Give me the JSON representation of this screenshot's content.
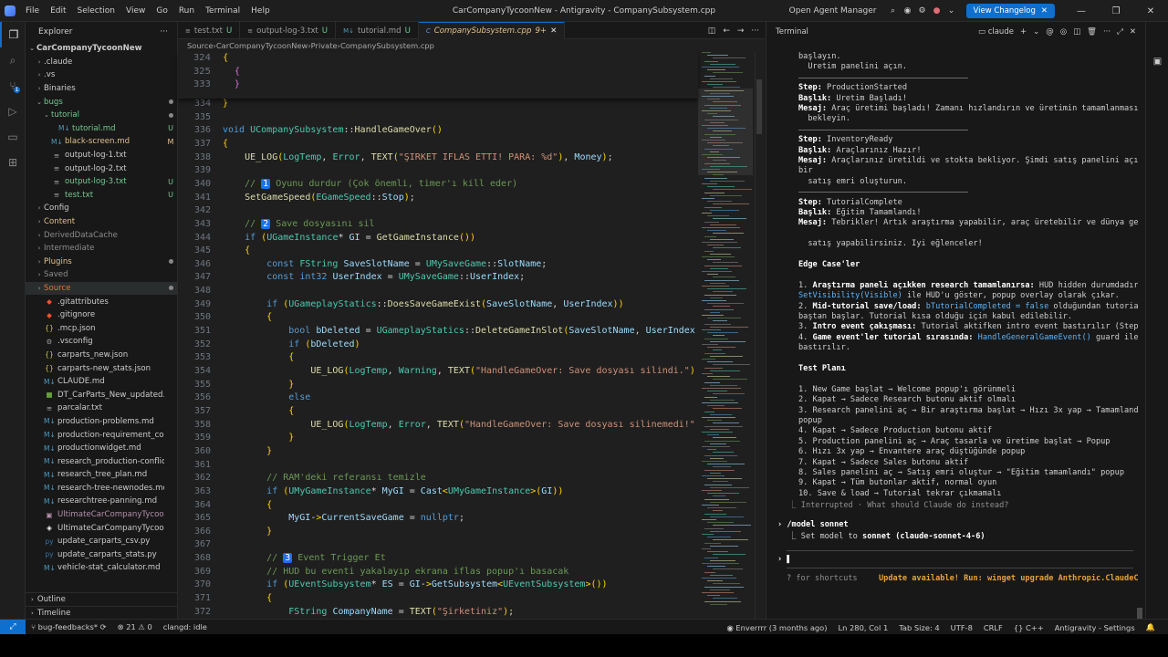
{
  "titlebar": {
    "menus": [
      "File",
      "Edit",
      "Selection",
      "View",
      "Go",
      "Run",
      "Terminal",
      "Help"
    ],
    "title": "CarCompanyTycoonNew - Antigravity - CompanySubsystem.cpp",
    "agent_manager": "Open Agent Manager",
    "changelog_button": "View Changelog"
  },
  "sidebar": {
    "title": "Explorer",
    "root": "CarCompanyTycoonNew",
    "items": [
      {
        "label": ".claude",
        "type": "folder",
        "indent": 1,
        "open": false,
        "status": ""
      },
      {
        "label": ".vs",
        "type": "folder",
        "indent": 1,
        "open": false,
        "status": ""
      },
      {
        "label": "Binaries",
        "type": "folder",
        "indent": 1,
        "open": false,
        "status": ""
      },
      {
        "label": "bugs",
        "type": "folder",
        "indent": 1,
        "open": true,
        "status": "dot",
        "color": "#73c991"
      },
      {
        "label": "tutorial",
        "type": "folder",
        "indent": 2,
        "open": true,
        "status": "dot",
        "color": "#73c991"
      },
      {
        "label": "tutorial.md",
        "type": "md",
        "indent": 3,
        "status": "U",
        "color": "#73c991"
      },
      {
        "label": "black-screen.md",
        "type": "md",
        "indent": 2,
        "status": "M",
        "color": "#e2c08d"
      },
      {
        "label": "output-log-1.txt",
        "type": "txt",
        "indent": 2,
        "status": "",
        "color": "#cccccc"
      },
      {
        "label": "output-log-2.txt",
        "type": "txt",
        "indent": 2,
        "status": "",
        "color": "#cccccc"
      },
      {
        "label": "output-log-3.txt",
        "type": "txt",
        "indent": 2,
        "status": "U",
        "color": "#73c991"
      },
      {
        "label": "test.txt",
        "type": "txt",
        "indent": 2,
        "status": "U",
        "color": "#73c991"
      },
      {
        "label": "Config",
        "type": "folder",
        "indent": 1,
        "open": false,
        "status": ""
      },
      {
        "label": "Content",
        "type": "folder",
        "indent": 1,
        "open": false,
        "status": "",
        "color": "#e2c08d"
      },
      {
        "label": "DerivedDataCache",
        "type": "folder",
        "indent": 1,
        "open": false,
        "status": "",
        "color": "#8c8c8c"
      },
      {
        "label": "Intermediate",
        "type": "folder",
        "indent": 1,
        "open": false,
        "status": "",
        "color": "#8c8c8c"
      },
      {
        "label": "Plugins",
        "type": "folder",
        "indent": 1,
        "open": false,
        "status": "dot",
        "color": "#e2c08d"
      },
      {
        "label": "Saved",
        "type": "folder",
        "indent": 1,
        "open": false,
        "status": "",
        "color": "#8c8c8c"
      },
      {
        "label": "Source",
        "type": "folder",
        "indent": 1,
        "open": false,
        "status": "dot",
        "color": "#e8733a",
        "selected": true
      },
      {
        "label": ".gitattributes",
        "type": "git",
        "indent": 1,
        "status": ""
      },
      {
        "label": ".gitignore",
        "type": "git",
        "indent": 1,
        "status": ""
      },
      {
        "label": ".mcp.json",
        "type": "json",
        "indent": 1,
        "status": ""
      },
      {
        "label": ".vsconfig",
        "type": "cfg",
        "indent": 1,
        "status": ""
      },
      {
        "label": "carparts_new.json",
        "type": "json",
        "indent": 1,
        "status": ""
      },
      {
        "label": "carparts-new_stats.json",
        "type": "json",
        "indent": 1,
        "status": ""
      },
      {
        "label": "CLAUDE.md",
        "type": "md",
        "indent": 1,
        "status": ""
      },
      {
        "label": "DT_CarParts_New_updated.csv",
        "type": "csv",
        "indent": 1,
        "status": ""
      },
      {
        "label": "parcalar.txt",
        "type": "txt",
        "indent": 1,
        "status": ""
      },
      {
        "label": "production-problems.md",
        "type": "md",
        "indent": 1,
        "status": ""
      },
      {
        "label": "production-requirement_conflict...",
        "type": "md",
        "indent": 1,
        "status": ""
      },
      {
        "label": "productionwidget.md",
        "type": "md",
        "indent": 1,
        "status": ""
      },
      {
        "label": "research_production-conflicts.md",
        "type": "md",
        "indent": 1,
        "status": ""
      },
      {
        "label": "research_tree_plan.md",
        "type": "md",
        "indent": 1,
        "status": ""
      },
      {
        "label": "research-tree-newnodes.md",
        "type": "md",
        "indent": 1,
        "status": ""
      },
      {
        "label": "researchtree-panning.md",
        "type": "md",
        "indent": 1,
        "status": ""
      },
      {
        "label": "UltimateCarCompanyTycoon.sln",
        "type": "sln",
        "indent": 1,
        "status": "",
        "color": "#b48ead"
      },
      {
        "label": "UltimateCarCompanyTycoon.upr...",
        "type": "upr",
        "indent": 1,
        "status": ""
      },
      {
        "label": "update_carparts_csv.py",
        "type": "py",
        "indent": 1,
        "status": ""
      },
      {
        "label": "update_carparts_stats.py",
        "type": "py",
        "indent": 1,
        "status": ""
      },
      {
        "label": "vehicle-stat_calculator.md",
        "type": "md",
        "indent": 1,
        "status": ""
      }
    ],
    "outline": "Outline",
    "timeline": "Timeline"
  },
  "tabs": [
    {
      "label": "test.txt",
      "mark": "U",
      "active": false
    },
    {
      "label": "output-log-3.txt",
      "mark": "U",
      "active": false
    },
    {
      "label": "tutorial.md",
      "mark": "U",
      "active": false
    },
    {
      "label": "CompanySubsystem.cpp",
      "mark": "9+",
      "active": true
    }
  ],
  "breadcrumb": [
    "Source",
    "CarCompanyTycoonNew",
    "Private",
    "CompanySubsystem.cpp"
  ],
  "code": {
    "sticky": [
      {
        "n": "324",
        "t": "{",
        "i": 0
      },
      {
        "n": "325",
        "t": "{",
        "i": 1
      },
      {
        "n": "333",
        "t": "}",
        "i": 1
      }
    ],
    "lines": [
      {
        "n": "334",
        "t": "}"
      },
      {
        "n": "335",
        "t": ""
      },
      {
        "n": "336",
        "t": "void UCompanySubsystem::HandleGameOver()"
      },
      {
        "n": "337",
        "t": "{"
      },
      {
        "n": "338",
        "t": "    UE_LOG(LogTemp, Error, TEXT(\"ŞİRKET İFLAS ETTİ! PARA: %d\"), Money);"
      },
      {
        "n": "339",
        "t": ""
      },
      {
        "n": "340",
        "t": "    // 1 Oyunu durdur (Çok önemli, timer'ı kill eder)"
      },
      {
        "n": "341",
        "t": "    SetGameSpeed(EGameSpeed::Stop);"
      },
      {
        "n": "342",
        "t": ""
      },
      {
        "n": "343",
        "t": "    // 2 Save dosyasını sil"
      },
      {
        "n": "344",
        "t": "    if (UGameInstance* GI = GetGameInstance())"
      },
      {
        "n": "345",
        "t": "    {"
      },
      {
        "n": "346",
        "t": "        const FString SaveSlotName = UMySaveGame::SlotName;"
      },
      {
        "n": "347",
        "t": "        const int32 UserIndex = UMySaveGame::UserIndex;"
      },
      {
        "n": "348",
        "t": ""
      },
      {
        "n": "349",
        "t": "        if (UGameplayStatics::DoesSaveGameExist(SaveSlotName, UserIndex))"
      },
      {
        "n": "350",
        "t": "        {"
      },
      {
        "n": "351",
        "t": "            bool bDeleted = UGameplayStatics::DeleteGameInSlot(SaveSlotName, UserIndex"
      },
      {
        "n": "352",
        "t": "            if (bDeleted)"
      },
      {
        "n": "353",
        "t": "            {"
      },
      {
        "n": "354",
        "t": "                UE_LOG(LogTemp, Warning, TEXT(\"HandleGameOver: Save dosyası silindi.\")"
      },
      {
        "n": "355",
        "t": "            }"
      },
      {
        "n": "356",
        "t": "            else"
      },
      {
        "n": "357",
        "t": "            {"
      },
      {
        "n": "358",
        "t": "                UE_LOG(LogTemp, Error, TEXT(\"HandleGameOver: Save dosyası silinemedi!\""
      },
      {
        "n": "359",
        "t": "            }"
      },
      {
        "n": "360",
        "t": "        }"
      },
      {
        "n": "361",
        "t": ""
      },
      {
        "n": "362",
        "t": "        // RAM'deki referansı temizle"
      },
      {
        "n": "363",
        "t": "        if (UMyGameInstance* MyGI = Cast<UMyGameInstance>(GI))"
      },
      {
        "n": "364",
        "t": "        {"
      },
      {
        "n": "365",
        "t": "            MyGI->CurrentSaveGame = nullptr;"
      },
      {
        "n": "366",
        "t": "        }"
      },
      {
        "n": "367",
        "t": ""
      },
      {
        "n": "368",
        "t": "        // 3 Event Trigger Et"
      },
      {
        "n": "369",
        "t": "        // HUD bu eventi yakalayıp ekrana iflas popup'ı basacak"
      },
      {
        "n": "370",
        "t": "        if (UEventSubsystem* ES = GI->GetSubsystem<UEventSubsystem>())"
      },
      {
        "n": "371",
        "t": "        {"
      },
      {
        "n": "372",
        "t": "            FString CompanyName = TEXT(\"Şirketiniz\");"
      }
    ]
  },
  "terminal": {
    "title": "Terminal",
    "session": "claude",
    "lines": [
      {
        "t": "başlayın.",
        "k": "plain"
      },
      {
        "t": "  Üretim panelini açın.",
        "k": "plain"
      },
      {
        "t": "",
        "k": "hr"
      },
      {
        "t": "Step: ProductionStarted",
        "k": "step"
      },
      {
        "t": "Başlık: Üretim Başladı!",
        "k": "kv"
      },
      {
        "t": "Mesaj: Araç üretimi başladı! Zamanı hızlandırın ve üretimin tamamlanmasını",
        "k": "kv"
      },
      {
        "t": "  bekleyin.",
        "k": "plain"
      },
      {
        "t": "",
        "k": "hr"
      },
      {
        "t": "Step: InventoryReady",
        "k": "step"
      },
      {
        "t": "Başlık: Araçlarınız Hazır!",
        "k": "kv"
      },
      {
        "t": "Mesaj: Araçlarınız üretildi ve stokta bekliyor. Şimdi satış panelini açın ve",
        "k": "kv"
      },
      {
        "t": "bir",
        "k": "plain"
      },
      {
        "t": "  satış emri oluşturun.",
        "k": "plain"
      },
      {
        "t": "",
        "k": "hr"
      },
      {
        "t": "Step: TutorialComplete",
        "k": "step"
      },
      {
        "t": "Başlık: Eğitim Tamamlandı!",
        "k": "kv"
      },
      {
        "t": "Mesaj: Tebrikler! Artık araştırma yapabilir, araç üretebilir ve dünya genelinde",
        "k": "kv"
      },
      {
        "t": "",
        "k": "blank"
      },
      {
        "t": "  satış yapabilirsiniz. İyi eğlenceler!",
        "k": "plain"
      },
      {
        "t": "",
        "k": "blank"
      },
      {
        "t": "Edge Case'ler",
        "k": "heading"
      },
      {
        "t": "",
        "k": "blank"
      },
      {
        "t": "1. Araştırma paneli açıkken research tamamlanırsa: HUD hidden durumdadır.",
        "k": "edge1"
      },
      {
        "t": "SetVisibility(Visible) ile HUD'u göster, popup overlay olarak çıkar.",
        "k": "edge1b"
      },
      {
        "t": "2. Mid-tutorial save/load: bTutorialCompleted = false olduğundan tutorial",
        "k": "edge2"
      },
      {
        "t": "baştan başlar. Tutorial kısa olduğu için kabul edilebilir.",
        "k": "plain"
      },
      {
        "t": "3. Intro event çakışması: Tutorial aktifken intro event bastırılır (Step 4).",
        "k": "edge3"
      },
      {
        "t": "4. Game event'ler tutorial sırasında: HandleGeneralGameEvent() guard ile",
        "k": "edge4"
      },
      {
        "t": "bastırılır.",
        "k": "plain"
      },
      {
        "t": "",
        "k": "blank"
      },
      {
        "t": "Test Planı",
        "k": "heading"
      },
      {
        "t": "",
        "k": "blank"
      },
      {
        "t": "1. New Game başlat → Welcome popup'ı görünmeli",
        "k": "plain"
      },
      {
        "t": "2. Kapat → Sadece Research butonu aktif olmalı",
        "k": "plain"
      },
      {
        "t": "3. Research panelini aç → Bir araştırma başlat → Hızı 3x yap → Tamamlandığında",
        "k": "plain"
      },
      {
        "t": "popup",
        "k": "plain"
      },
      {
        "t": "4. Kapat → Sadece Production butonu aktif",
        "k": "plain"
      },
      {
        "t": "5. Production panelini aç → Araç tasarla ve üretime başlat → Popup",
        "k": "plain"
      },
      {
        "t": "6. Hızı 3x yap → Envantere araç düştüğünde popup",
        "k": "plain"
      },
      {
        "t": "7. Kapat → Sadece Sales butonu aktif",
        "k": "plain"
      },
      {
        "t": "8. Sales panelini aç → Satış emri oluştur → \"Eğitim tamamlandı\" popup",
        "k": "plain"
      },
      {
        "t": "9. Kapat → Tüm butonlar aktif, normal oyun",
        "k": "plain"
      },
      {
        "t": "10. Save & load → Tutorial tekrar çıkmamalı",
        "k": "plain"
      }
    ],
    "interrupted": "Interrupted · What should Claude do instead?",
    "command": "/model sonnet",
    "result_prefix": "Set model to ",
    "result_model": "sonnet (claude-sonnet-4-6)",
    "prompt": "›",
    "shortcuts": "? for shortcuts",
    "update": "Update available! Run: winget upgrade Anthropic.ClaudeCode"
  },
  "statusbar": {
    "branch": "bug-feedbacks*",
    "errors": "21",
    "warnings": "0",
    "clangd": "clangd: idle",
    "git_user": "Enverrrr (3 months ago)",
    "position": "Ln 280, Col 1",
    "tab_size": "Tab Size: 4",
    "encoding": "UTF-8",
    "eol": "CRLF",
    "language": "C++",
    "settings": "Antigravity - Settings"
  },
  "colors": {
    "accent": "#0e6fce",
    "untracked": "#73c991",
    "modified": "#e2c08d"
  }
}
